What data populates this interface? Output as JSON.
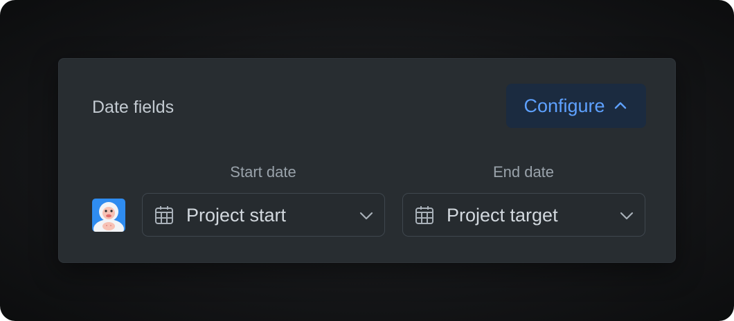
{
  "panel": {
    "title": "Date fields",
    "configure_label": "Configure"
  },
  "columns": {
    "start_label": "Start date",
    "end_label": "End date"
  },
  "start_field": {
    "selected_value": "Project start",
    "icon": "calendar-icon"
  },
  "end_field": {
    "selected_value": "Project target",
    "icon": "calendar-icon"
  },
  "user": {
    "avatar_icon": "yeti-avatar"
  },
  "colors": {
    "accent": "#5ea1ff",
    "button_bg": "#1b2b40",
    "panel_bg": "#282d31",
    "text_primary": "#d2d8de",
    "text_muted": "#9aa3ab"
  }
}
